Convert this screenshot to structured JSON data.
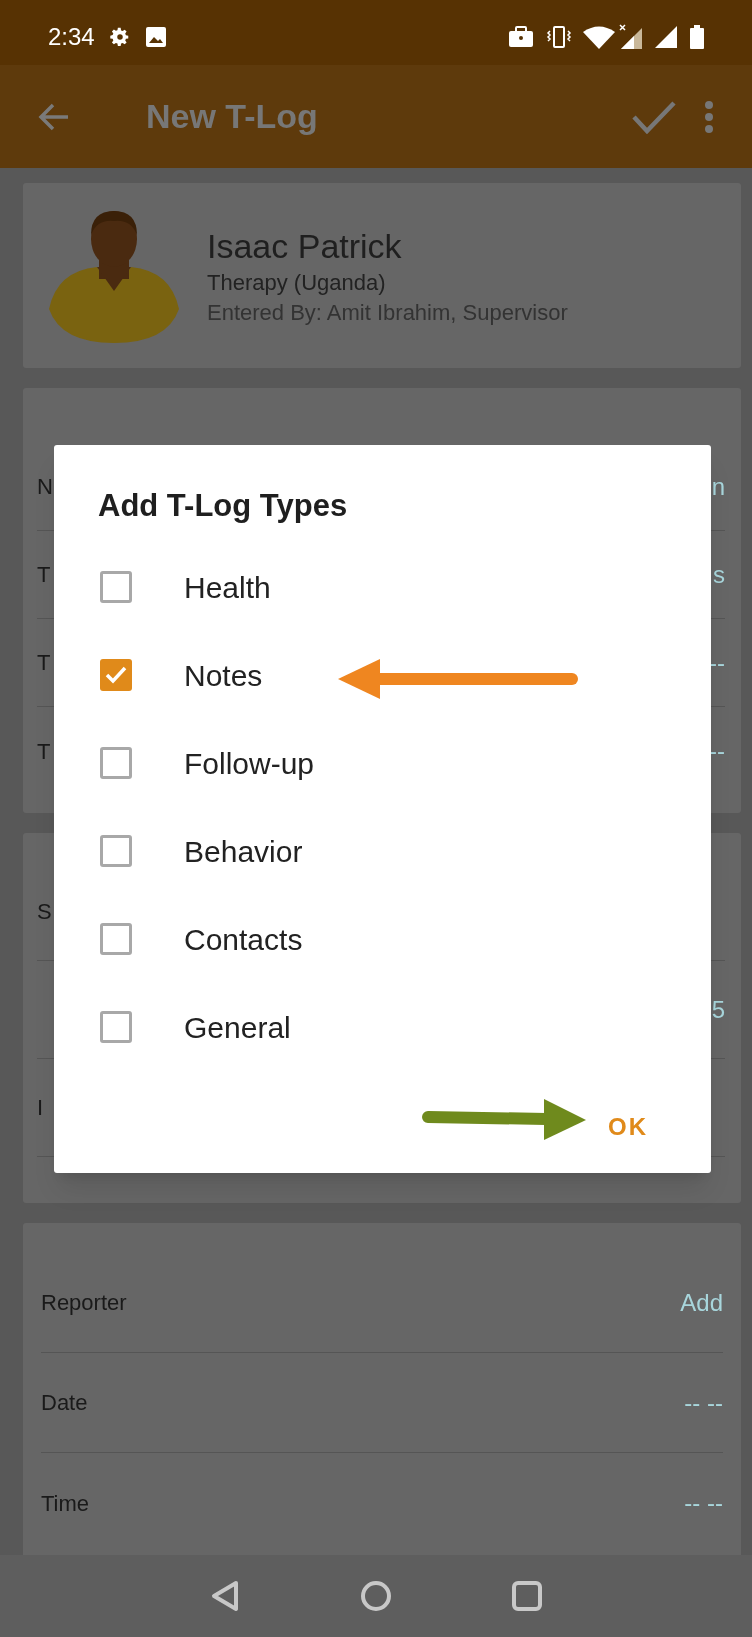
{
  "status_bar": {
    "time": "2:34"
  },
  "app_bar": {
    "title": "New T-Log"
  },
  "profile": {
    "name": "Isaac Patrick",
    "program": "Therapy (Uganda)",
    "entered_by": "Entered By: Amit Ibrahim, Supervisor"
  },
  "details_rows": [
    {
      "label": "N",
      "value": "n"
    },
    {
      "label": "T",
      "value": "s"
    },
    {
      "label": "T",
      "value": "--"
    },
    {
      "label": "T",
      "value": "--"
    }
  ],
  "notes_rows": [
    {
      "label": "S"
    },
    {
      "value": "5"
    },
    {
      "label": "I"
    }
  ],
  "reporter_rows": [
    {
      "label": "Reporter",
      "value": "Add"
    },
    {
      "label": "Date",
      "value": "-- --"
    },
    {
      "label": "Time",
      "value": "-- --"
    }
  ],
  "dialog": {
    "title": "Add T-Log Types",
    "options": [
      {
        "label": "Health",
        "checked": false
      },
      {
        "label": "Notes",
        "checked": true
      },
      {
        "label": "Follow-up",
        "checked": false
      },
      {
        "label": "Behavior",
        "checked": false
      },
      {
        "label": "Contacts",
        "checked": false
      },
      {
        "label": "General",
        "checked": false
      }
    ],
    "ok_button": "OK"
  }
}
